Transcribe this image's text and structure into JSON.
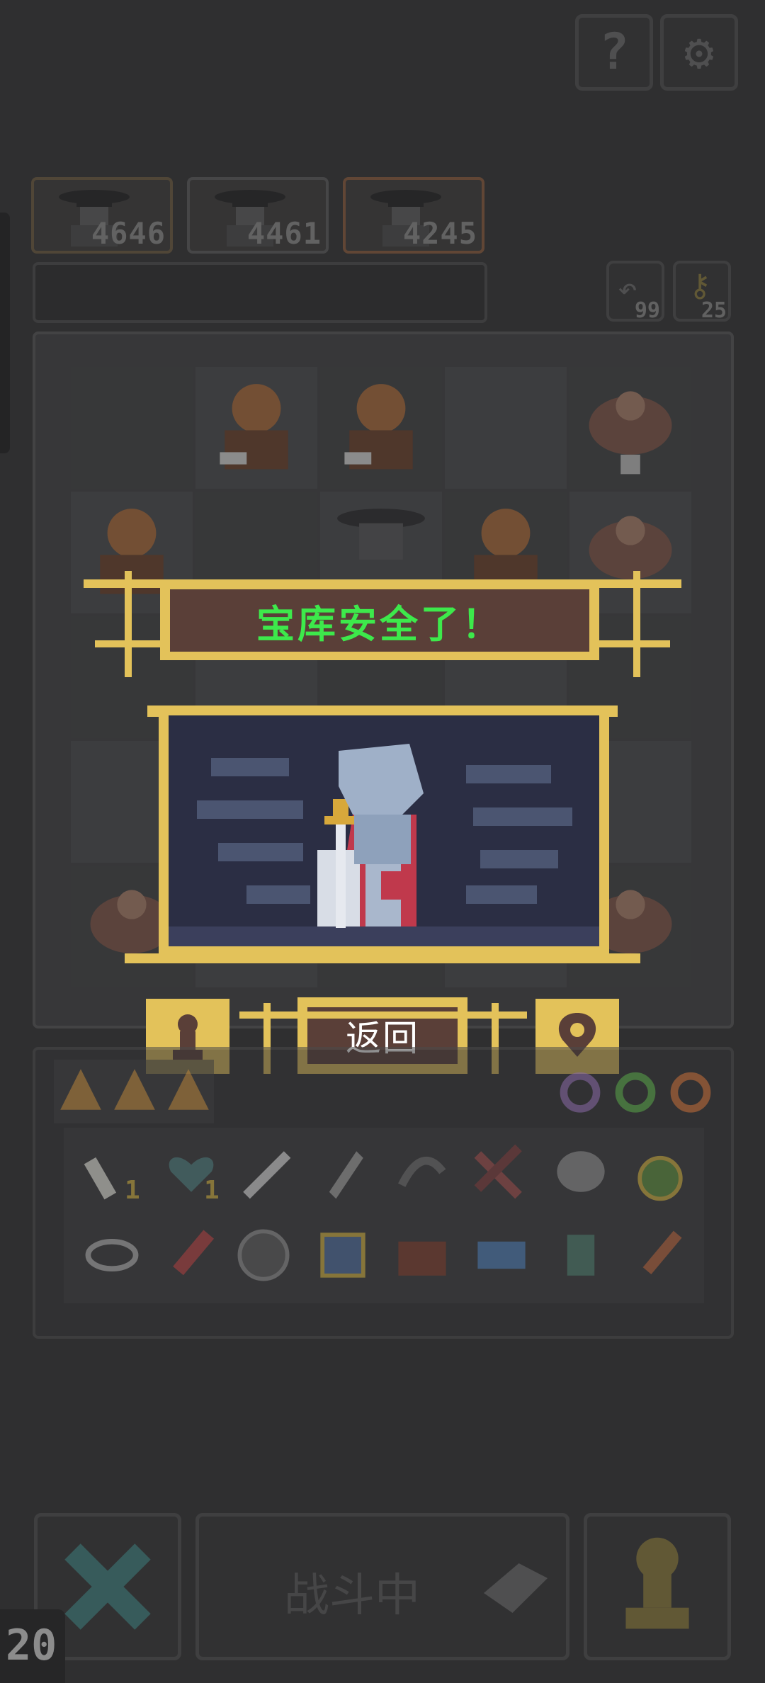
{
  "top_buttons": [
    {
      "icon": "question-icon",
      "glyph": "?"
    },
    {
      "icon": "gear-icon",
      "glyph": "⚙"
    }
  ],
  "enemy_cards": [
    {
      "value": "4646"
    },
    {
      "value": "4461"
    },
    {
      "value": "4245"
    }
  ],
  "counters": {
    "undo": {
      "icon": "undo-icon",
      "value": "99"
    },
    "key": {
      "icon": "key-icon",
      "value": "25"
    }
  },
  "dialog": {
    "title": "宝库安全了！",
    "return_label": "返回",
    "left_icon": "pawn-icon",
    "right_icon": "map-pin-icon"
  },
  "inventory": {
    "ammo_icons": [
      "wedge-icon",
      "wedge-icon",
      "wedge-icon"
    ],
    "ring_icons": [
      "purple-ring-icon",
      "green-ring-icon",
      "orange-ring-icon"
    ],
    "items_row1": [
      {
        "icon": "bone-icon",
        "qty": "1"
      },
      {
        "icon": "heart-gem-icon",
        "qty": "1"
      },
      {
        "icon": "knife-icon",
        "qty": ""
      },
      {
        "icon": "feather-icon",
        "qty": ""
      },
      {
        "icon": "claw-icon",
        "qty": ""
      },
      {
        "icon": "ribbon-icon",
        "qty": ""
      },
      {
        "icon": "stone-icon",
        "qty": ""
      },
      {
        "icon": "potion-icon",
        "qty": ""
      }
    ],
    "items_row2": [
      {
        "icon": "eye-glyph-icon",
        "qty": ""
      },
      {
        "icon": "syringe-icon",
        "qty": ""
      },
      {
        "icon": "shield-icon",
        "qty": ""
      },
      {
        "icon": "armor-icon",
        "qty": ""
      },
      {
        "icon": "chest-icon",
        "qty": ""
      },
      {
        "icon": "ticket-icon",
        "qty": ""
      },
      {
        "icon": "gauntlet-icon",
        "qty": ""
      },
      {
        "icon": "dagger-icon",
        "qty": ""
      }
    ]
  },
  "bottom_bar": {
    "battle_label": "战斗中",
    "cancel_icon": "x-icon",
    "pawn_icon": "pawn-icon"
  },
  "turn_counter": "20",
  "colors": {
    "gold": "#e3c25a",
    "title_green": "#3de94b",
    "dialog_brown": "#5a3f38",
    "bg": "#2f2f30"
  }
}
